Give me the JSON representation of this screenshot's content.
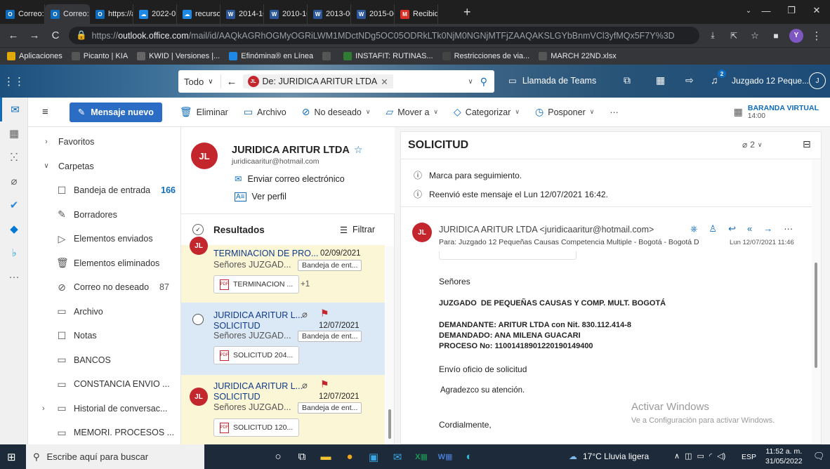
{
  "browser": {
    "tabs": [
      {
        "label": "Correo:",
        "icon": "O",
        "color": "#0f6cbd",
        "active": false
      },
      {
        "label": "Correo:",
        "icon": "O",
        "color": "#0f6cbd",
        "active": true
      },
      {
        "label": "https://a",
        "icon": "O",
        "color": "#0f6cbd",
        "active": false
      },
      {
        "label": "2022-01",
        "icon": "☁",
        "color": "#1e88e5",
        "active": false
      },
      {
        "label": "recursos",
        "icon": "☁",
        "color": "#1e88e5",
        "active": false
      },
      {
        "label": "2014-10",
        "icon": "W",
        "color": "#2b579a",
        "active": false
      },
      {
        "label": "2010-10",
        "icon": "W",
        "color": "#2b579a",
        "active": false
      },
      {
        "label": "2013-00",
        "icon": "W",
        "color": "#2b579a",
        "active": false
      },
      {
        "label": "2015-00",
        "icon": "W",
        "color": "#2b579a",
        "active": false
      },
      {
        "label": "Recibid",
        "icon": "M",
        "color": "#d93025",
        "active": false
      }
    ],
    "url_prefix": "https://",
    "url_host": "outlook.office.com",
    "url_path": "/mail/id/AAQkAGRhOGMyOGRiLWM1MDctNDg5OC05ODRkLTk0NjM0NGNjMTFjZAAQAKSLGYbBnmVCl3yfMQx5F7Y%3D",
    "profile_initial": "Y",
    "bookmarks": [
      {
        "label": "Aplicaciones",
        "color": "#e0a800"
      },
      {
        "label": "Picanto | KIA",
        "color": "#555555"
      },
      {
        "label": "KWID | Versiones |...",
        "color": "#666666"
      },
      {
        "label": "Efinómina® en Línea",
        "color": "#1e88e5"
      },
      {
        "label": "",
        "color": "#555555"
      },
      {
        "label": "INSTAFIT: RUTINAS...",
        "color": "#2e7d32"
      },
      {
        "label": "Restricciones de via...",
        "color": "#444444"
      },
      {
        "label": "MARCH 22ND.xlsx",
        "color": "#555555"
      }
    ]
  },
  "outlook": {
    "search_scope": "Todo",
    "search_chip": "De: JURIDICA ARITUR LTDA",
    "chip_initials": "JL",
    "teams_call": "Llamada de Teams",
    "notif_count": "2",
    "account_name": "Juzgado 12 Peque...",
    "account_initial": "J",
    "commands": {
      "new_mail": "Mensaje nuevo",
      "delete": "Eliminar",
      "archive": "Archivo",
      "junk": "No deseado",
      "move": "Mover a",
      "categorize": "Categorizar",
      "snooze": "Posponer",
      "more": "···",
      "calendar_event": "BARANDA VIRTUAL",
      "calendar_time": "14:00"
    },
    "folders": {
      "favorites": "Favoritos",
      "folders": "Carpetas",
      "items": [
        {
          "label": "Bandeja de entrada",
          "count": "166"
        },
        {
          "label": "Borradores",
          "count": ""
        },
        {
          "label": "Elementos enviados",
          "count": ""
        },
        {
          "label": "Elementos eliminados",
          "count": ""
        },
        {
          "label": "Correo no deseado",
          "count": "87"
        },
        {
          "label": "Archivo",
          "count": ""
        },
        {
          "label": "Notas",
          "count": ""
        },
        {
          "label": "BANCOS",
          "count": ""
        },
        {
          "label": "CONSTANCIA ENVIO ...",
          "count": ""
        },
        {
          "label": "Historial de conversac...",
          "count": ""
        },
        {
          "label": "MEMORI. PROCESOS ...",
          "count": ""
        }
      ]
    },
    "contact": {
      "initials": "JL",
      "name": "JURIDICA ARITUR LTDA",
      "email": "juridicaaritur@hotmail.com",
      "send_email": "Enviar correo electrónico",
      "view_profile": "Ver perfil"
    },
    "results": {
      "label": "Resultados",
      "filter": "Filtrar",
      "messages": [
        {
          "initials": "JL",
          "sender": "",
          "subject": "TERMINACION DE PRO...",
          "date": "02/09/2021",
          "preview": "Señores JUZGAD...",
          "folder": "Bandeja de ent...",
          "attachment": "TERMINACION ...",
          "extra": "+1"
        },
        {
          "initials": "",
          "sender": "JURIDICA ARITUR L...",
          "subject": "SOLICITUD",
          "date": "12/07/2021",
          "preview": "Señores JUZGAD...",
          "folder": "Bandeja de ent...",
          "attachment": "SOLICITUD 204...",
          "extra": ""
        },
        {
          "initials": "JL",
          "sender": "JURIDICA ARITUR L...",
          "subject": "SOLICITUD",
          "date": "12/07/2021",
          "preview": "Señores JUZGAD...",
          "folder": "Bandeja de ent...",
          "attachment": "SOLICITUD 120...",
          "extra": ""
        }
      ]
    },
    "reading": {
      "subject": "SOLICITUD",
      "attach_count": "2",
      "info1": "Marca para seguimiento.",
      "info2": "Reenvió este mensaje el Lun 12/07/2021 16:42.",
      "from_initials": "JL",
      "from": "JURIDICA ARITUR LTDA <juridicaaritur@hotmail.com>",
      "to": "Para: Juzgado 12 Pequeñas Causas Competencia Multiple - Bogotá - Bogotá D",
      "datetime": "Lun 12/07/2021 11:46",
      "body": {
        "greeting": "Señores",
        "court": "JUZGADO  DE PEQUEÑAS CAUSAS Y COMP. MULT. BOGOTÁ",
        "plaintiff": "DEMANDANTE: ARITUR LTDA con Nit. 830.112.414-8",
        "defendant": "DEMANDADO: ANA MILENA GUACARI",
        "process": "PROCESO No: 11001418901220190149400",
        "line1": "Envío oficio de solicitud",
        "line2": "Agradezco su atención.",
        "closing": "Cordialmente,"
      },
      "watermark1": "Activar Windows",
      "watermark2": "Ve a Configuración para activar Windows."
    }
  },
  "taskbar": {
    "search_placeholder": "Escribe aquí para buscar",
    "weather": "17°C  Lluvia ligera",
    "lang": "ESP",
    "time": "11:52 a. m.",
    "date": "31/05/2022"
  }
}
